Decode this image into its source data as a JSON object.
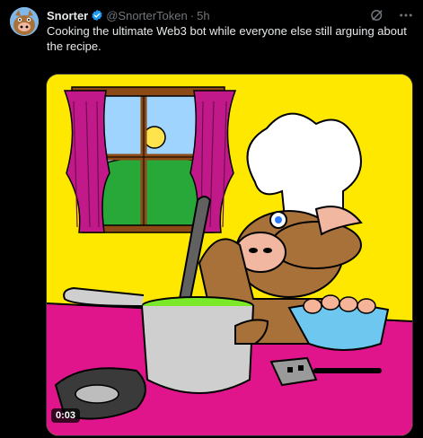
{
  "post": {
    "author_name": "Snorter",
    "handle": "@SnorterToken",
    "separator": "·",
    "time": "5h",
    "text": "Cooking the ultimate Web3 bot while everyone else still arguing about the recipe."
  },
  "media": {
    "video_time": "0:03"
  },
  "icons": {
    "verified": "verified-badge-icon",
    "grok": "grok-icon",
    "more": "more-icon"
  },
  "colors": {
    "background": "#000000",
    "text": "#e7e9ea",
    "muted": "#71767b",
    "verified": "#1d9bf0",
    "media_yellow": "#ffe800",
    "media_magenta": "#e0158c"
  }
}
